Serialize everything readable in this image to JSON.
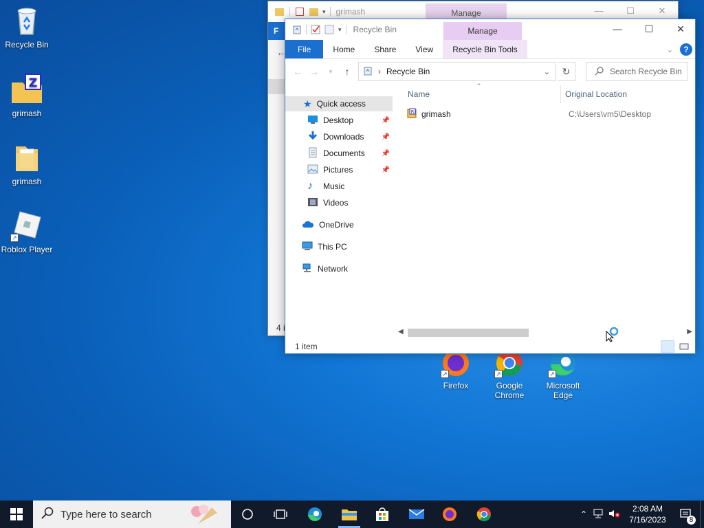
{
  "desktop": {
    "icons": [
      {
        "label": "Recycle Bin",
        "icon": "recycle-bin-icon"
      },
      {
        "label": "grimash",
        "icon": "zip-folder-icon"
      },
      {
        "label": "grimash",
        "icon": "folder-icon"
      },
      {
        "label": "Roblox Player",
        "icon": "roblox-icon"
      }
    ],
    "apps": [
      {
        "label": "Firefox",
        "icon": "firefox-icon"
      },
      {
        "label": "Google Chrome",
        "icon": "chrome-icon"
      },
      {
        "label": "Microsoft Edge",
        "icon": "edge-icon"
      }
    ]
  },
  "back_window": {
    "title": "grimash",
    "manage_tab": "Manage",
    "file_tab": "F",
    "status": "4 i"
  },
  "window": {
    "title": "Recycle Bin",
    "manage_tab": "Manage",
    "ribbon_tabs": [
      "File",
      "Home",
      "Share",
      "View",
      "Recycle Bin Tools"
    ],
    "address": "Recycle Bin",
    "search_placeholder": "Search Recycle Bin",
    "nav": [
      {
        "label": "Quick access",
        "icon": "star-icon",
        "pinned": false
      },
      {
        "label": "Desktop",
        "icon": "desktop-icon",
        "pinned": true
      },
      {
        "label": "Downloads",
        "icon": "download-icon",
        "pinned": true
      },
      {
        "label": "Documents",
        "icon": "document-icon",
        "pinned": true
      },
      {
        "label": "Pictures",
        "icon": "pictures-icon",
        "pinned": true
      },
      {
        "label": "Music",
        "icon": "music-icon",
        "pinned": false
      },
      {
        "label": "Videos",
        "icon": "videos-icon",
        "pinned": false
      },
      {
        "label": "OneDrive",
        "icon": "onedrive-icon",
        "pinned": false
      },
      {
        "label": "This PC",
        "icon": "pc-icon",
        "pinned": false
      },
      {
        "label": "Network",
        "icon": "network-icon",
        "pinned": false
      }
    ],
    "columns": {
      "name": "Name",
      "location": "Original Location"
    },
    "files": [
      {
        "name": "grimash",
        "location": "C:\\Users\\vm5\\Desktop",
        "icon": "rar-archive-icon"
      }
    ],
    "status": "1 item"
  },
  "taskbar": {
    "search_placeholder": "Type here to search",
    "time": "2:08 AM",
    "date": "7/16/2023",
    "notification_count": "8",
    "apps": [
      "cortana-icon",
      "task-view-icon",
      "edge-icon",
      "file-explorer-icon",
      "store-icon",
      "mail-icon",
      "firefox-icon",
      "chrome-icon"
    ]
  },
  "colors": {
    "accent": "#1a6fcf",
    "manage": "#e7cdf2",
    "taskbar": "#101a2b"
  }
}
